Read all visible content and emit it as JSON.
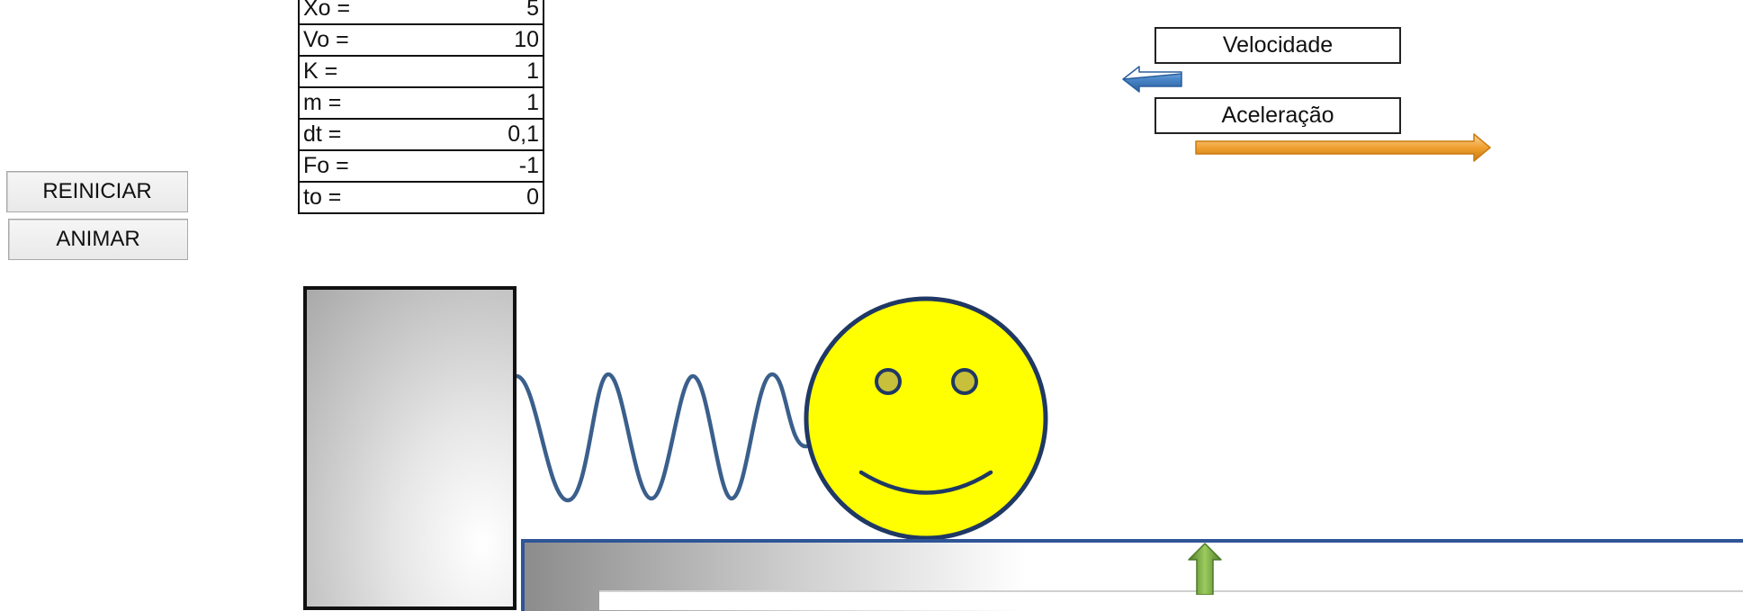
{
  "controls": {
    "reset_label": "REINICIAR",
    "animate_label": "ANIMAR"
  },
  "parameters": [
    {
      "label": "Xo =",
      "value": "5"
    },
    {
      "label": "Vo =",
      "value": "10"
    },
    {
      "label": "K =",
      "value": "1"
    },
    {
      "label": "m =",
      "value": "1"
    },
    {
      "label": "dt =",
      "value": "0,1"
    },
    {
      "label": "Fo =",
      "value": "-1"
    },
    {
      "label": "to =",
      "value": "0"
    }
  ],
  "legend": {
    "velocity_label": "Velocidade",
    "acceleration_label": "Aceleração"
  },
  "colors": {
    "velocity_arrow": "#4a86c8",
    "acceleration_arrow": "#f0a030",
    "normal_force_arrow": "#70a83a",
    "spring": "#3b5f8c",
    "ball_fill": "#ffff00",
    "ball_outline": "#1f3864"
  },
  "icons": {
    "velocity": "left-arrow",
    "acceleration": "right-arrow",
    "normal_force": "up-arrow",
    "ball": "smiley-face"
  }
}
